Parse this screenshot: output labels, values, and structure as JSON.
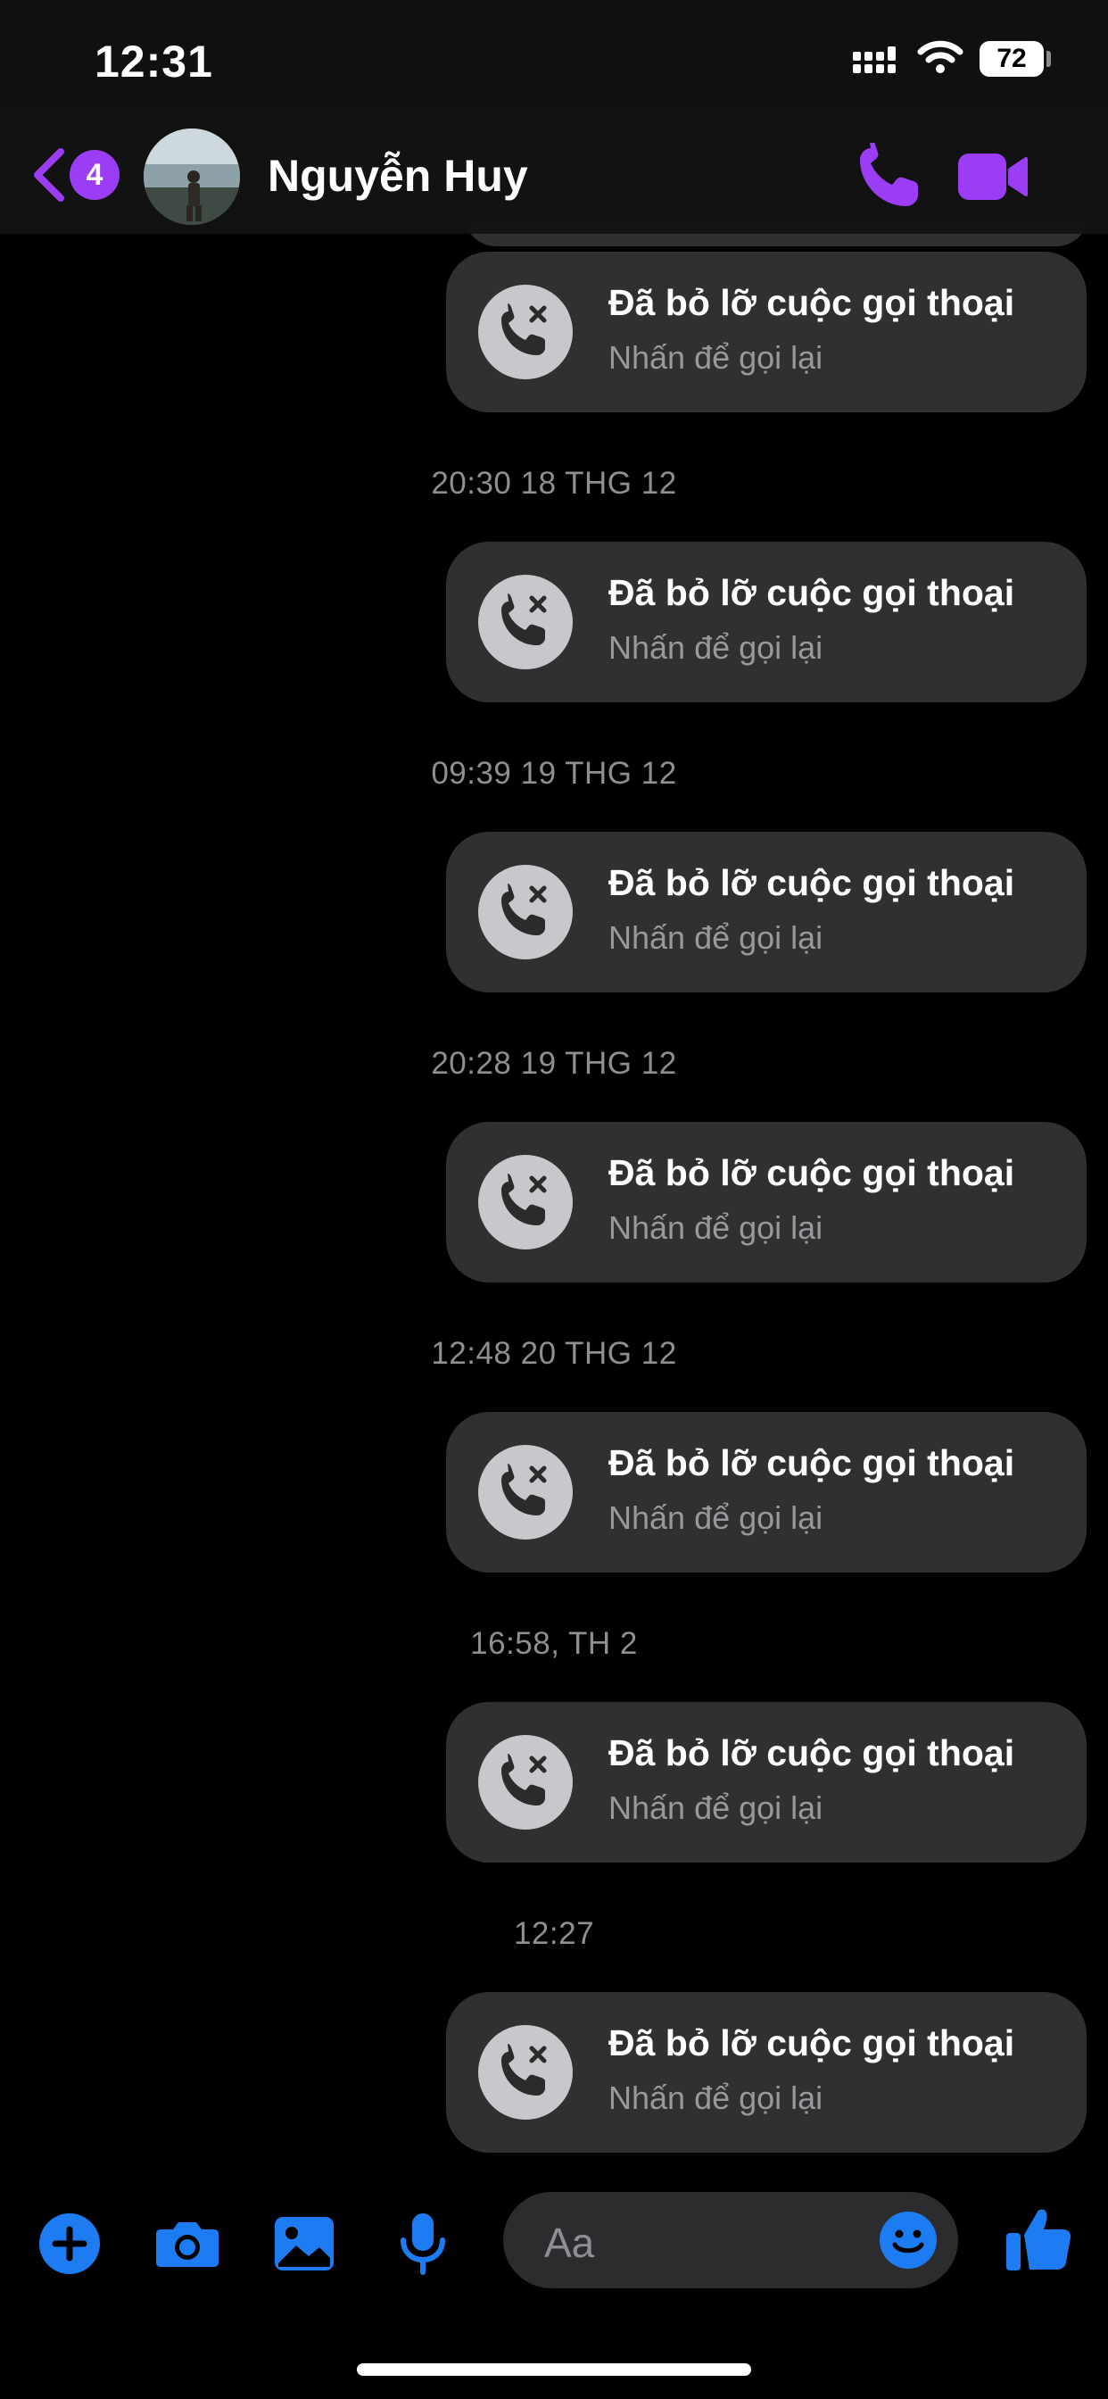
{
  "status_bar": {
    "time": "12:31",
    "battery": "72"
  },
  "header": {
    "back_badge": "4",
    "contact_name": "Nguyễn Huy"
  },
  "messages": [
    {
      "timestamp": "",
      "title": "Đã bỏ lỡ cuộc gọi thoại",
      "subtitle": "Nhấn để gọi lại"
    },
    {
      "timestamp": "20:30 18 THG 12",
      "title": "Đã bỏ lỡ cuộc gọi thoại",
      "subtitle": "Nhấn để gọi lại"
    },
    {
      "timestamp": "09:39 19 THG 12",
      "title": "Đã bỏ lỡ cuộc gọi thoại",
      "subtitle": "Nhấn để gọi lại"
    },
    {
      "timestamp": "20:28 19 THG 12",
      "title": "Đã bỏ lỡ cuộc gọi thoại",
      "subtitle": "Nhấn để gọi lại"
    },
    {
      "timestamp": "12:48 20 THG 12",
      "title": "Đã bỏ lỡ cuộc gọi thoại",
      "subtitle": "Nhấn để gọi lại"
    },
    {
      "timestamp": "16:58, TH 2",
      "title": "Đã bỏ lỡ cuộc gọi thoại",
      "subtitle": "Nhấn để gọi lại"
    },
    {
      "timestamp": "12:27",
      "title": "Đã bỏ lỡ cuộc gọi thoại",
      "subtitle": "Nhấn để gọi lại"
    }
  ],
  "composer": {
    "placeholder": "Aa"
  },
  "icons": {
    "accent": "#9b3df5",
    "composer_blue": "#1e7cf2",
    "missed_call": "missed-call-icon"
  }
}
